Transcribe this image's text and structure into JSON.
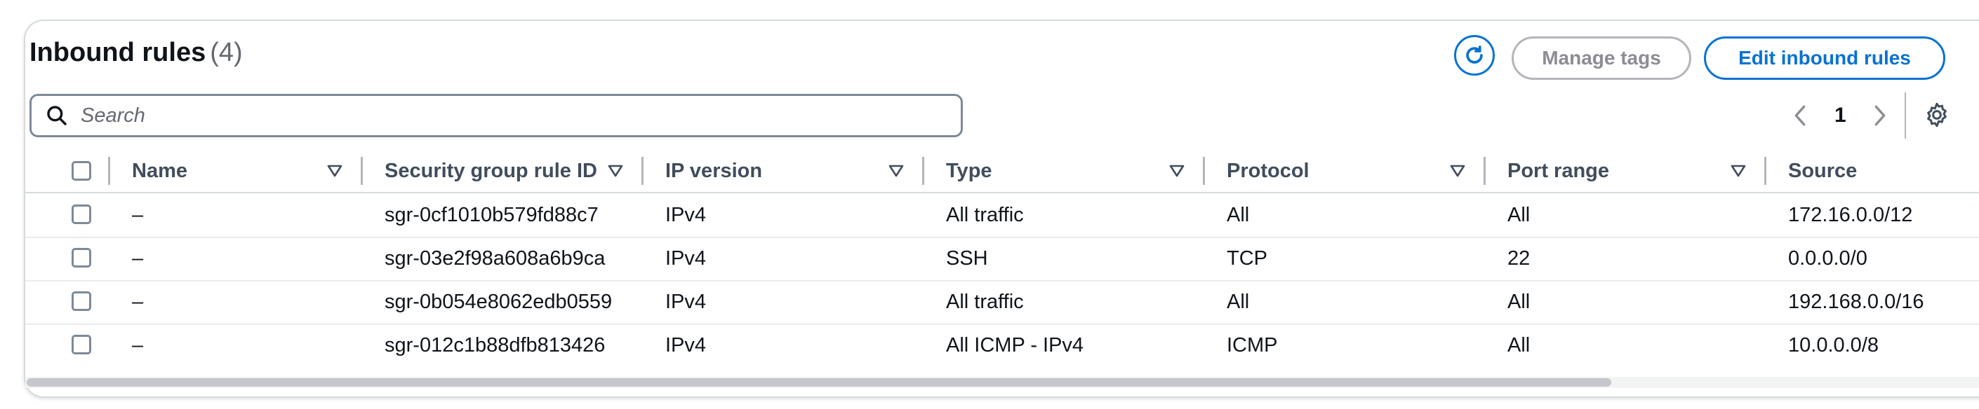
{
  "header": {
    "title": "Inbound rules",
    "count": "(4)",
    "manage_tags_label": "Manage tags",
    "edit_label": "Edit inbound rules"
  },
  "search": {
    "placeholder": "Search",
    "value": ""
  },
  "pagination": {
    "current_page": "1"
  },
  "columns": [
    "Name",
    "Security group rule ID",
    "IP version",
    "Type",
    "Protocol",
    "Port range",
    "Source"
  ],
  "rows": [
    {
      "name": "–",
      "rule_id": "sgr-0cf1010b579fd88c7",
      "ip_version": "IPv4",
      "type": "All traffic",
      "protocol": "All",
      "port_range": "All",
      "source": "172.16.0.0/12"
    },
    {
      "name": "–",
      "rule_id": "sgr-03e2f98a608a6b9ca",
      "ip_version": "IPv4",
      "type": "SSH",
      "protocol": "TCP",
      "port_range": "22",
      "source": "0.0.0.0/0"
    },
    {
      "name": "–",
      "rule_id": "sgr-0b054e8062edb0559",
      "ip_version": "IPv4",
      "type": "All traffic",
      "protocol": "All",
      "port_range": "All",
      "source": "192.168.0.0/16"
    },
    {
      "name": "–",
      "rule_id": "sgr-012c1b88dfb813426",
      "ip_version": "IPv4",
      "type": "All ICMP - IPv4",
      "protocol": "ICMP",
      "port_range": "All",
      "source": "10.0.0.0/8"
    }
  ],
  "colors": {
    "primary": "#0972d3",
    "disabled": "#8c8c94",
    "border": "#7d8998",
    "header_text": "#414d5c"
  },
  "icons": {
    "refresh": "refresh-icon",
    "search": "search-icon",
    "prev": "chevron-left-icon",
    "next": "chevron-right-icon",
    "settings": "gear-icon",
    "sort": "sort-caret-icon"
  }
}
